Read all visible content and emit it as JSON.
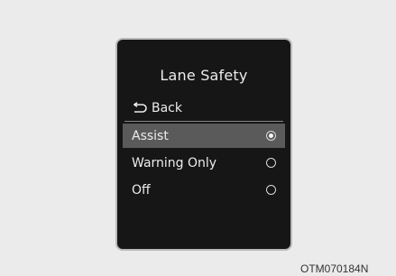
{
  "screen": {
    "title": "Lane Safety",
    "back_label": "Back",
    "options": [
      {
        "label": "Assist",
        "selected": true
      },
      {
        "label": "Warning Only",
        "selected": false
      },
      {
        "label": "Off",
        "selected": false
      }
    ]
  },
  "figure_code": "OTM070184N",
  "colors": {
    "screen_background": "#161616",
    "selected_row": "#5a5a5a",
    "text": "#ececec",
    "page_background": "#ebebeb"
  },
  "icons": {
    "back": "back-arrow-icon",
    "radio_selected": "radio-selected-icon",
    "radio_unselected": "radio-unselected-icon"
  }
}
